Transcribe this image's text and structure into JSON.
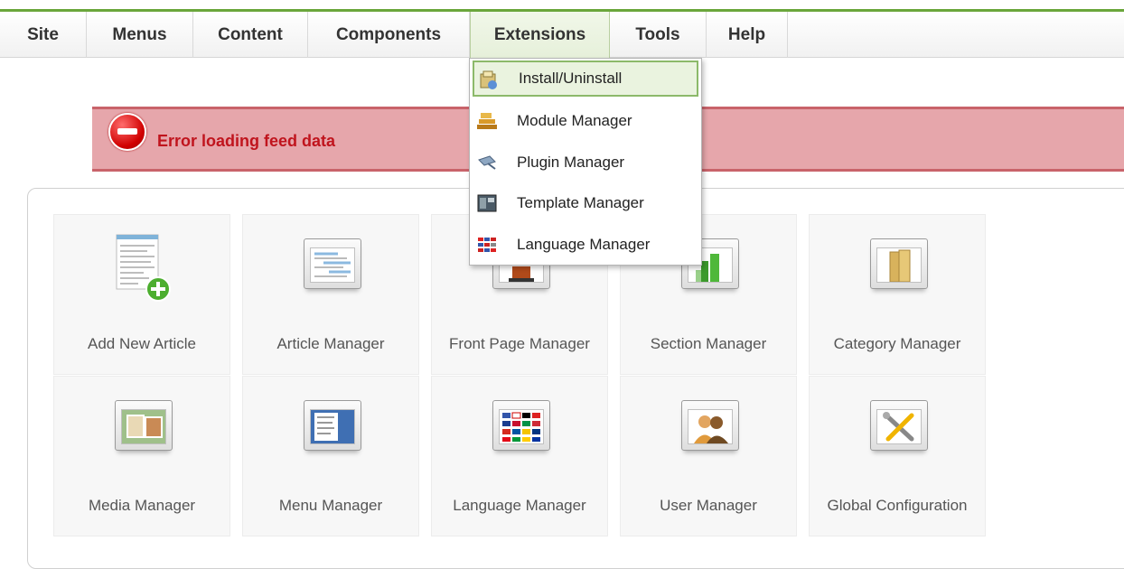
{
  "menu": {
    "items": [
      {
        "label": "Site"
      },
      {
        "label": "Menus"
      },
      {
        "label": "Content"
      },
      {
        "label": "Components"
      },
      {
        "label": "Extensions"
      },
      {
        "label": "Tools"
      },
      {
        "label": "Help"
      }
    ],
    "active": "Extensions"
  },
  "extensions_dropdown": {
    "items": [
      {
        "label": "Install/Uninstall",
        "icon": "install-icon"
      },
      {
        "label": "Module Manager",
        "icon": "module-icon"
      },
      {
        "label": "Plugin Manager",
        "icon": "plugin-icon"
      },
      {
        "label": "Template Manager",
        "icon": "template-icon"
      },
      {
        "label": "Language Manager",
        "icon": "language-icon"
      }
    ],
    "highlighted": "Install/Uninstall"
  },
  "error": {
    "message": "Error loading feed data"
  },
  "cpanel": {
    "tiles": [
      {
        "label": "Add New Article",
        "icon": "add-article-icon"
      },
      {
        "label": "Article Manager",
        "icon": "article-manager-icon"
      },
      {
        "label": "Front Page Manager",
        "icon": "frontpage-icon"
      },
      {
        "label": "Section Manager",
        "icon": "section-icon"
      },
      {
        "label": "Category Manager",
        "icon": "category-icon"
      },
      {
        "label": "Media Manager",
        "icon": "media-icon"
      },
      {
        "label": "Menu Manager",
        "icon": "menu-manager-icon"
      },
      {
        "label": "Language Manager",
        "icon": "language-flags-icon"
      },
      {
        "label": "User Manager",
        "icon": "users-icon"
      },
      {
        "label": "Global Configuration",
        "icon": "tools-icon"
      }
    ]
  },
  "colors": {
    "accent_green": "#6aa63b",
    "error_bg": "#e6a6ab",
    "error_text": "#c0141d"
  }
}
